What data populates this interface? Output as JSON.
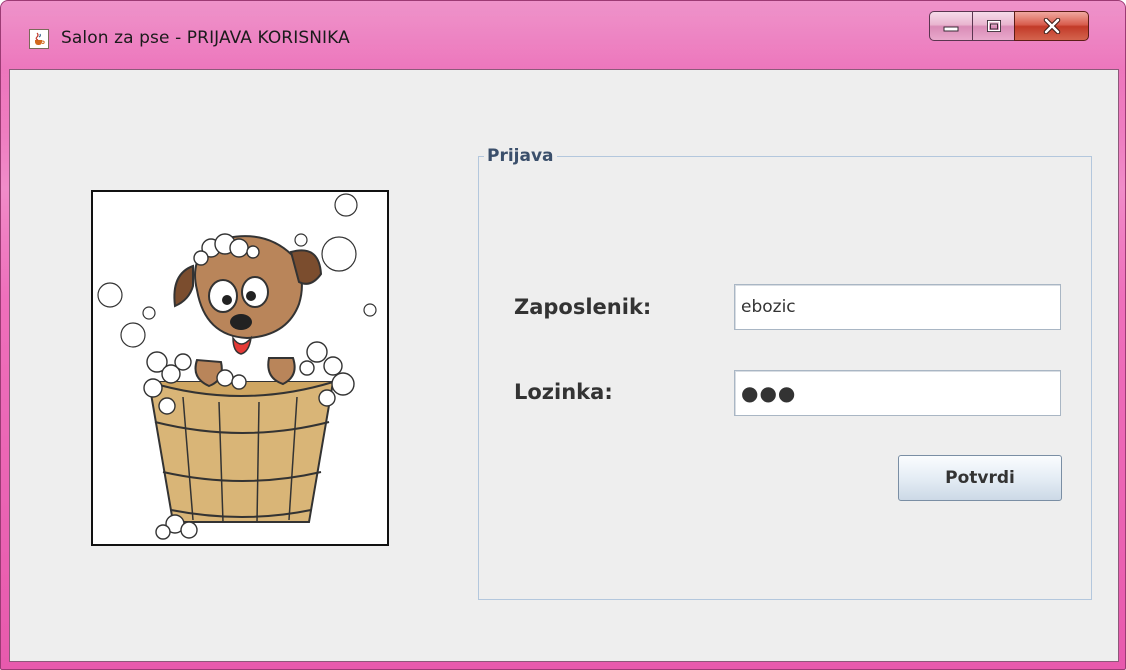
{
  "window": {
    "title": "Salon za pse - PRIJAVA KORISNIKA",
    "accent_color": "#ea5fb1"
  },
  "login_panel": {
    "legend": "Prijava",
    "username_label": "Zaposlenik:",
    "username_value": "ebozic",
    "password_label": "Lozinka:",
    "password_masked": "●●●",
    "submit_label": "Potvrdi"
  },
  "icons": {
    "app": "java-cup-icon",
    "minimize": "minimize-icon",
    "maximize": "maximize-icon",
    "close": "close-icon",
    "illustration": "dog-in-bathtub-illustration"
  }
}
